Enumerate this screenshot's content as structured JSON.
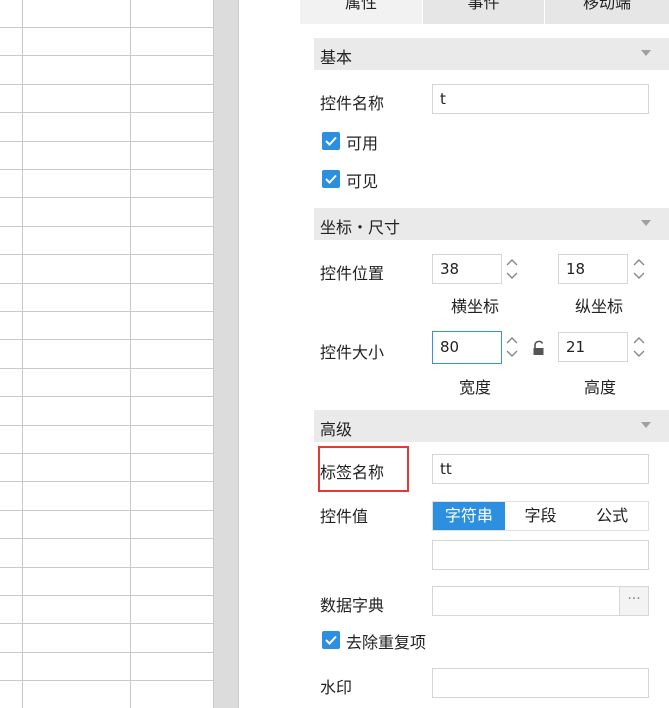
{
  "tabs": [
    "属性",
    "事件",
    "移动端"
  ],
  "sections": {
    "basic": "基本",
    "coords": "坐标・尺寸",
    "advanced": "高级"
  },
  "basic": {
    "name_label": "控件名称",
    "name_value": "t",
    "enabled_label": "可用",
    "visible_label": "可见"
  },
  "position": {
    "label": "控件位置",
    "x_value": "38",
    "y_value": "18",
    "x_caption": "横坐标",
    "y_caption": "纵坐标"
  },
  "size": {
    "label": "控件大小",
    "w_value": "80",
    "h_value": "21",
    "w_caption": "宽度",
    "h_caption": "高度"
  },
  "advanced": {
    "tag_label": "标签名称",
    "tag_value": "tt",
    "value_label": "控件值",
    "value_options": [
      "字符串",
      "字段",
      "公式"
    ],
    "value_selected": "字符串",
    "value_input": "",
    "dict_label": "数据字典",
    "dict_value": "",
    "dict_button": "···",
    "dedupe_label": "去除重复项",
    "watermark_label": "水印",
    "watermark_value": ""
  },
  "colors": {
    "accent": "#2d8fe0",
    "highlight": "#e53935"
  }
}
